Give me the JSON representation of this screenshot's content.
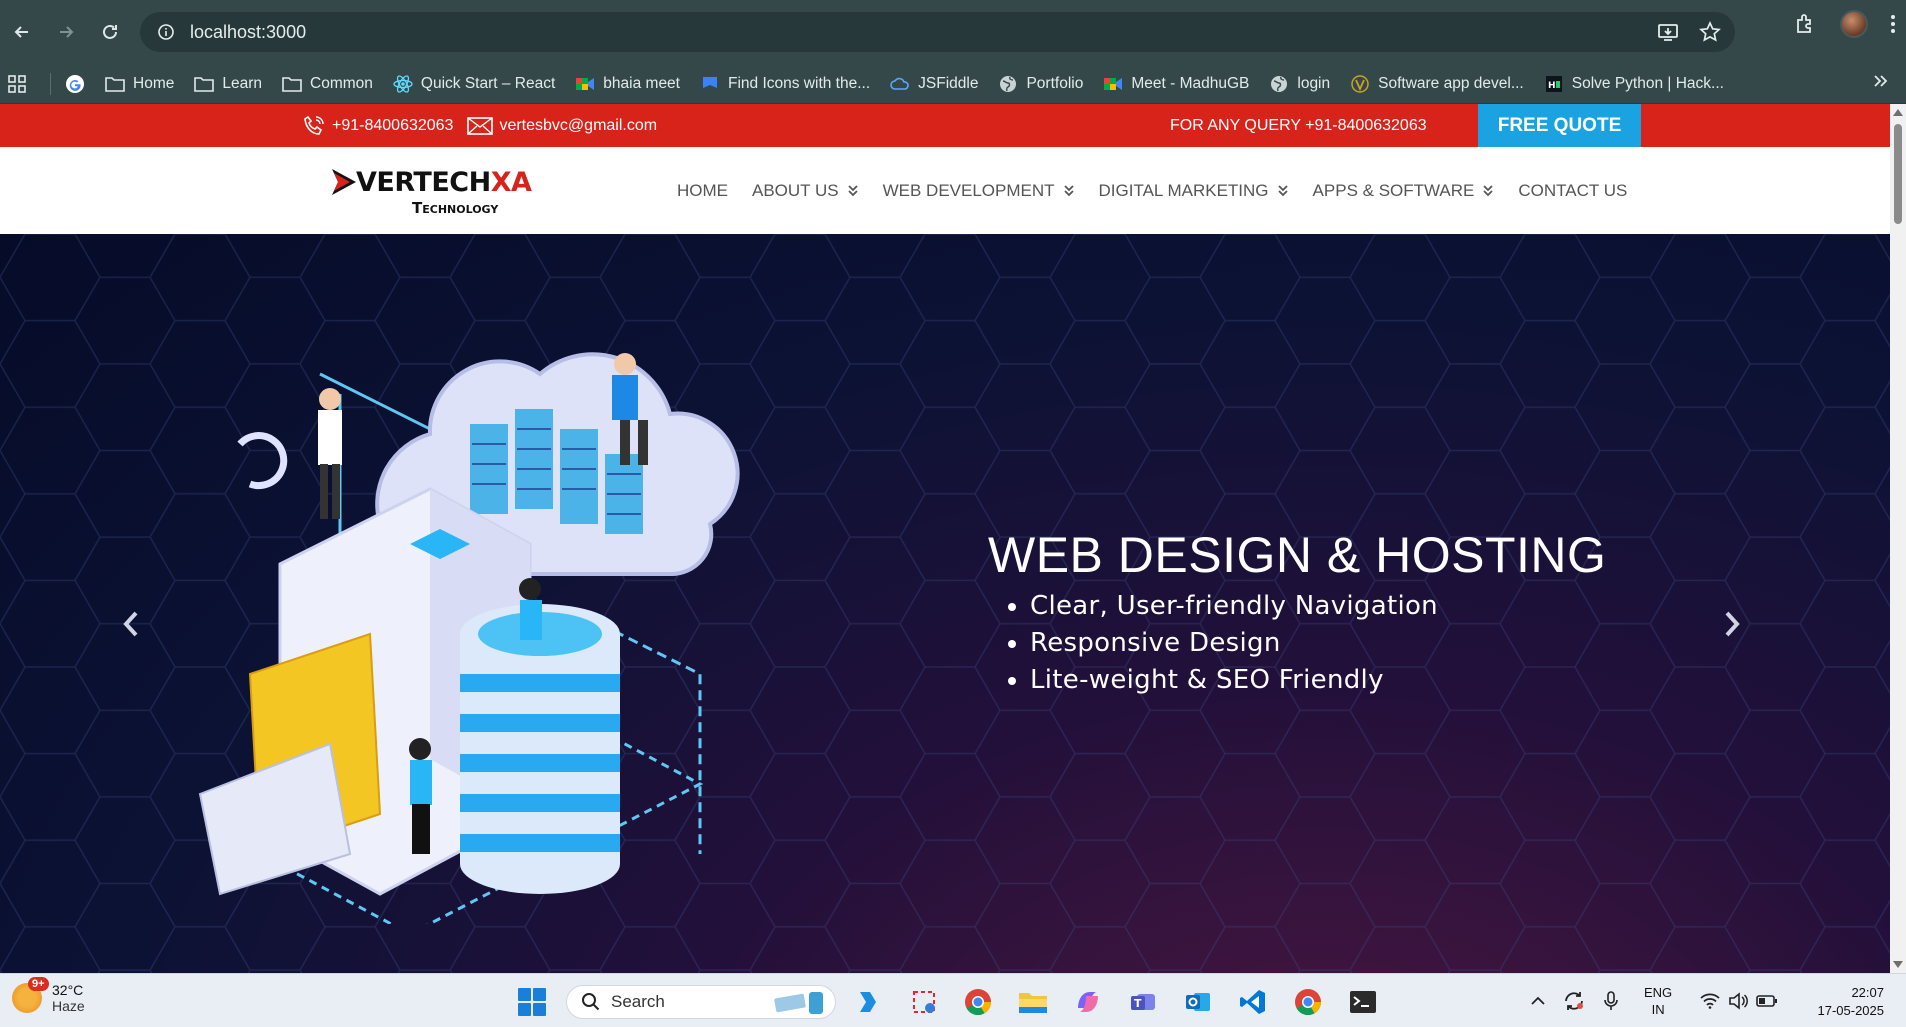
{
  "browser": {
    "url": "localhost:3000",
    "bookmarks": [
      {
        "label": "",
        "icon": "google-icon"
      },
      {
        "label": "Home",
        "icon": "folder-icon"
      },
      {
        "label": "Learn",
        "icon": "folder-icon"
      },
      {
        "label": "Common",
        "icon": "folder-icon"
      },
      {
        "label": "Quick Start – React",
        "icon": "react-icon"
      },
      {
        "label": "bhaia meet",
        "icon": "meet-icon"
      },
      {
        "label": "Find Icons with the...",
        "icon": "flag-icon"
      },
      {
        "label": "JSFiddle",
        "icon": "cloud-icon"
      },
      {
        "label": "Portfolio",
        "icon": "globe-icon"
      },
      {
        "label": "Meet - MadhuGB",
        "icon": "meet-icon"
      },
      {
        "label": "login",
        "icon": "globe-icon"
      },
      {
        "label": "Software app devel...",
        "icon": "v-icon"
      },
      {
        "label": "Solve Python | Hack...",
        "icon": "hackerrank-icon"
      }
    ]
  },
  "site": {
    "topbar": {
      "phone": "+91-8400632063",
      "email": "vertesbvc@gmail.com",
      "query": "FOR ANY QUERY +91-8400632063",
      "quote_button": "FREE QUOTE"
    },
    "logo": {
      "name_main": "VERTECH",
      "name_accent": "XA",
      "subtitle": "Technology"
    },
    "menu": [
      {
        "label": "HOME",
        "dropdown": false
      },
      {
        "label": "ABOUT US",
        "dropdown": true
      },
      {
        "label": "WEB DEVELOPMENT",
        "dropdown": true
      },
      {
        "label": "DIGITAL MARKETING",
        "dropdown": true
      },
      {
        "label": "APPS & SOFTWARE",
        "dropdown": true
      },
      {
        "label": "CONTACT US",
        "dropdown": false
      }
    ],
    "hero": {
      "title": "WEB DESIGN & HOSTING",
      "bullets": [
        "Clear, User-friendly Navigation",
        "Responsive Design",
        "Lite-weight & SEO Friendly"
      ]
    },
    "colors": {
      "topbar": "#d7231a",
      "quote": "#1aa3e0",
      "hero_bg": "#0b1030"
    }
  },
  "taskbar": {
    "weather_temp": "32°C",
    "weather_desc": "Haze",
    "weather_badge": "9+",
    "search_placeholder": "Search",
    "lang_line1": "ENG",
    "lang_line2": "IN",
    "time": "22:07",
    "date": "17-05-2025"
  }
}
